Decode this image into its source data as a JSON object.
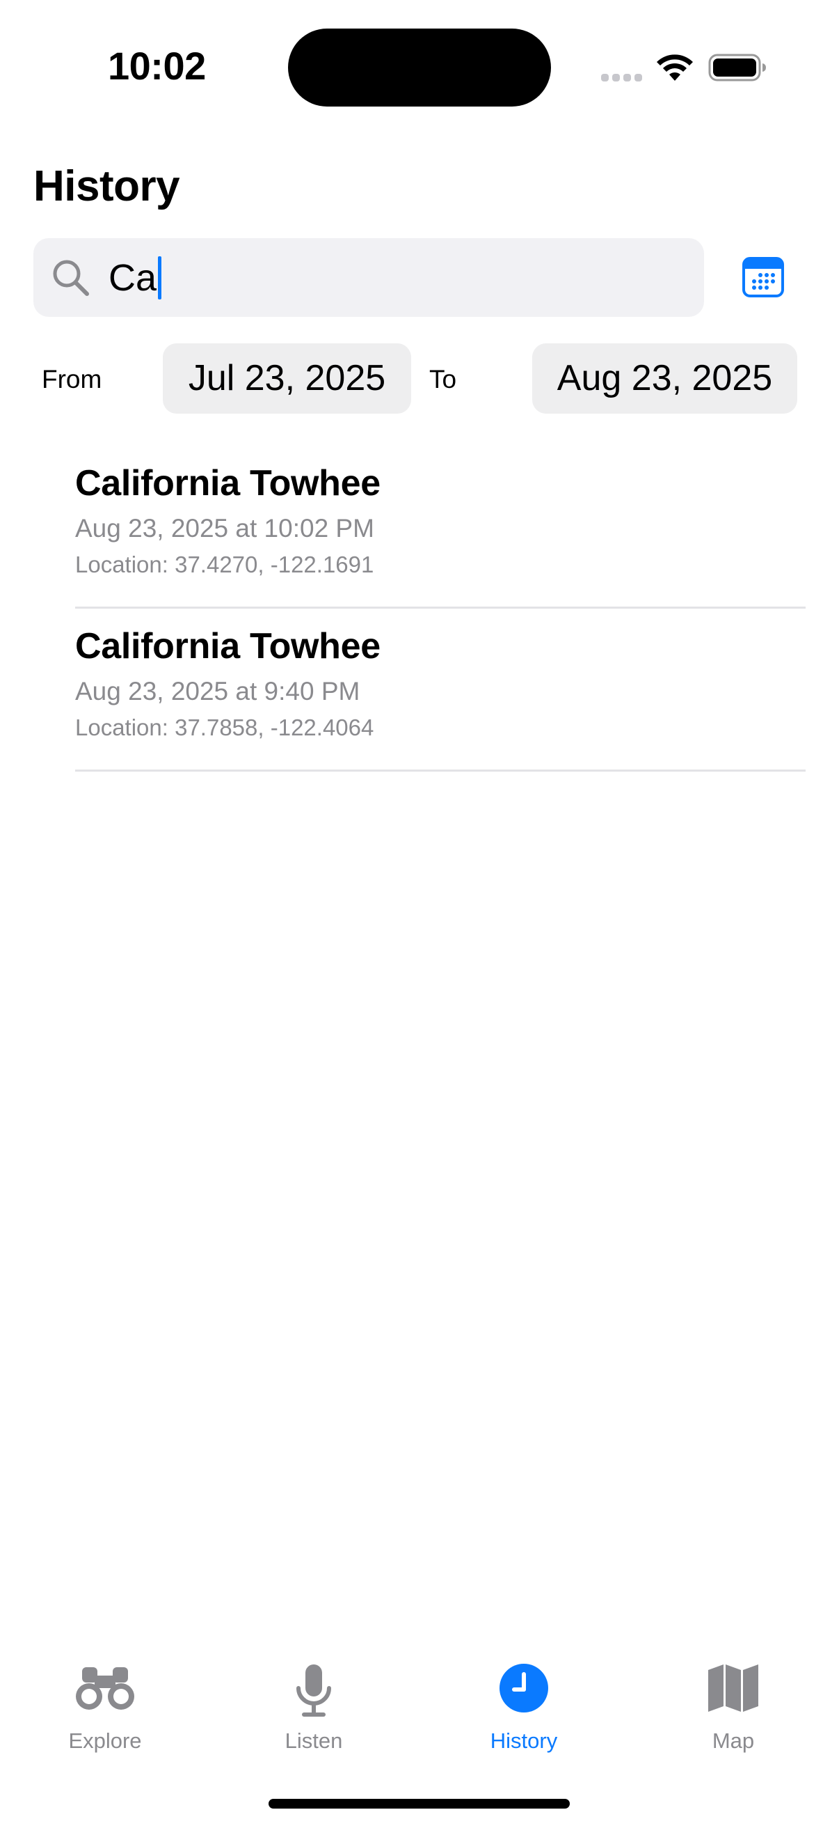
{
  "status_bar": {
    "time": "10:02"
  },
  "page": {
    "title": "History"
  },
  "search": {
    "value": "Ca"
  },
  "date_range": {
    "from_label": "From",
    "from_value": "Jul 23, 2025",
    "to_label": "To",
    "to_value": "Aug 23, 2025"
  },
  "history": [
    {
      "title": "California Towhee",
      "date": "Aug 23, 2025 at 10:02 PM",
      "location": "Location: 37.4270, -122.1691"
    },
    {
      "title": "California Towhee",
      "date": "Aug 23, 2025 at 9:40 PM",
      "location": "Location: 37.7858, -122.4064"
    }
  ],
  "tabs": [
    {
      "label": "Explore",
      "icon": "binoculars-icon",
      "active": false
    },
    {
      "label": "Listen",
      "icon": "microphone-icon",
      "active": false
    },
    {
      "label": "History",
      "icon": "clock-icon",
      "active": true
    },
    {
      "label": "Map",
      "icon": "map-icon",
      "active": false
    }
  ],
  "colors": {
    "accent": "#0a7aff",
    "secondary_text": "#8a8a8e",
    "field_background": "#f1f1f4"
  }
}
